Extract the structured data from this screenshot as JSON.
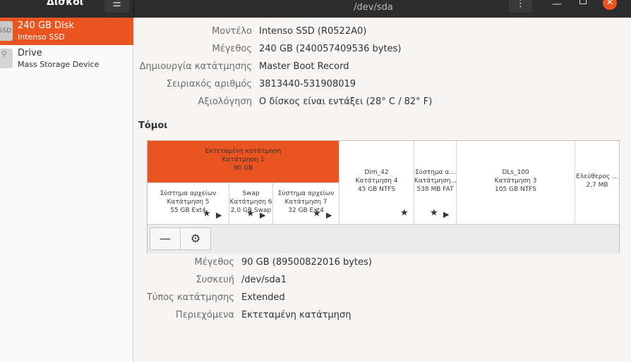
{
  "header": {
    "app_title": "Δίσκοι",
    "menu_icon": "hamburger-icon",
    "window_title": "/dev/sda",
    "kebab_icon": "vertical-dots-icon"
  },
  "sidebar": {
    "items": [
      {
        "icon": "ssd-icon",
        "icon_text": "SSD",
        "name": "240 GB Disk",
        "sub": "Intenso SSD",
        "selected": true
      },
      {
        "icon": "usb-drive-icon",
        "name": "Drive",
        "sub": "Mass Storage Device",
        "selected": false
      }
    ]
  },
  "disk_info": {
    "model_label": "Μοντέλο",
    "model_value": "Intenso SSD (R0522A0)",
    "size_label": "Μέγεθος",
    "size_value": "240 GB (240057409536 bytes)",
    "partitioning_label": "Δημιουργία κατάτμησης",
    "partitioning_value": "Master Boot Record",
    "serial_label": "Σειριακός αριθμός",
    "serial_value": "3813440-531908019",
    "assessment_label": "Αξιολόγηση",
    "assessment_value": "Ο δίσκος είναι εντάξει (28° C / 82° F)"
  },
  "volumes": {
    "title": "Τόμοι",
    "extended": {
      "l1": "Εκτεταμένη κατάτμηση",
      "l2": "Κατάτμηση 1",
      "l3": "90 GB"
    },
    "logical": [
      {
        "l1": "Σύστημα αρχείων",
        "l2": "Κατάτμηση 5",
        "l3": "55 GB Ext4"
      },
      {
        "l1": "Swap",
        "l2": "Κατάτμηση 6",
        "l3": "2,0 GB Swap"
      },
      {
        "l1": "Σύστημα αρχείων",
        "l2": "Κατάτμηση 7",
        "l3": "32 GB Ext4"
      }
    ],
    "primary": [
      {
        "l1": "Dim_42",
        "l2": "Κατάτμηση 4",
        "l3": "45 GB NTFS"
      },
      {
        "l1": "Σύστημα α...",
        "l2": "Κατάτμηση...",
        "l3": "538 MB FAT"
      },
      {
        "l1": "DLs_100",
        "l2": "Κατάτμηση 3",
        "l3": "105 GB NTFS"
      },
      {
        "l1": "Ελεύθερος ...",
        "l2": "2,7 MB"
      }
    ],
    "toolbar": {
      "remove_label": "—",
      "settings_icon": "gears-icon"
    }
  },
  "selected_volume": {
    "size_label": "Μέγεθος",
    "size_value": "90 GB (89500822016 bytes)",
    "device_label": "Συσκευή",
    "device_value": "/dev/sda1",
    "type_label": "Τύπος κατάτμησης",
    "type_value": "Extended",
    "contents_label": "Περιεχόμενα",
    "contents_value": "Εκτεταμένη κατάτμηση"
  }
}
